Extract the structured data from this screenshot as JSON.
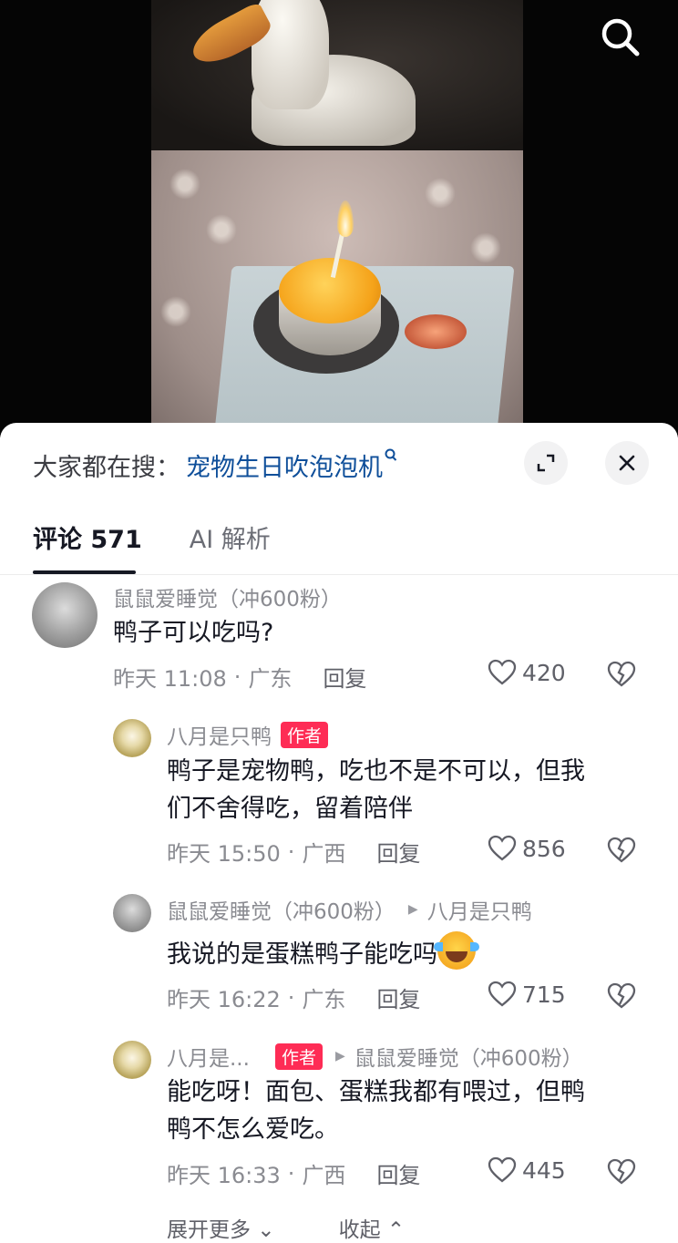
{
  "top": {
    "search_icon": "search-icon"
  },
  "sheet": {
    "search_prefix": "大家都在搜：",
    "search_term": "宠物生日吹泡泡机",
    "expand_icon": "expand-icon",
    "close_icon": "close-icon"
  },
  "tabs": [
    {
      "label": "评论 571",
      "active": true
    },
    {
      "label": "AI 解析",
      "active": false
    }
  ],
  "comments": [
    {
      "user": "鼠鼠爱睡觉（冲600粉）",
      "text": "鸭子可以吃吗?",
      "time": "昨天 11:08",
      "location": "广东",
      "reply": "回复",
      "likes": "420"
    },
    {
      "user": "八月是只鸭",
      "badge": "作者",
      "text_line1": "鸭子是宠物鸭，吃也不是不可以，但我",
      "text_line2": "们不舍得吃，留着陪伴",
      "time": "昨天 15:50",
      "location": "广西",
      "reply": "回复",
      "likes": "856"
    },
    {
      "user": "鼠鼠爱睡觉（冲600粉）",
      "reply_to": "八月是只鸭",
      "text": "我说的是蛋糕鸭子能吃吗",
      "time": "昨天 16:22",
      "location": "广东",
      "reply": "回复",
      "likes": "715"
    },
    {
      "user": "八月是...",
      "badge": "作者",
      "reply_to": "鼠鼠爱睡觉（冲600粉）",
      "text_line1": "能吃呀！面包、蛋糕我都有喂过，但鸭",
      "text_line2": "鸭不怎么爱吃。",
      "time": "昨天 16:33",
      "location": "广西",
      "reply": "回复",
      "likes": "445"
    }
  ],
  "footer": {
    "expand_more": "展开更多",
    "collapse": "收起"
  },
  "colors": {
    "accent_link": "#0f4f9a",
    "author_badge": "#fe2c55"
  }
}
